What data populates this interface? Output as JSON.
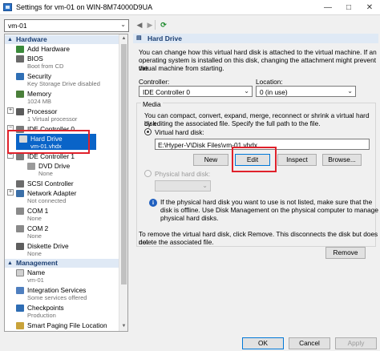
{
  "window": {
    "title": "Settings for vm-01 on WIN-8M74000D9UA"
  },
  "toolbar": {
    "vm_name": "vm-01"
  },
  "tree": {
    "hardware_header": "Hardware",
    "management_header": "Management",
    "items": [
      {
        "label": "Add Hardware",
        "sub": ""
      },
      {
        "label": "BIOS",
        "sub": "Boot from CD"
      },
      {
        "label": "Security",
        "sub": "Key Storage Drive disabled"
      },
      {
        "label": "Memory",
        "sub": "1024 MB"
      },
      {
        "label": "Processor",
        "sub": "1 Virtual processor"
      },
      {
        "label": "IDE Controller 0",
        "sub": ""
      },
      {
        "label": "Hard Drive",
        "sub": "vm-01.vhdx"
      },
      {
        "label": "IDE Controller 1",
        "sub": ""
      },
      {
        "label": "DVD Drive",
        "sub": "None"
      },
      {
        "label": "SCSI Controller",
        "sub": ""
      },
      {
        "label": "Network Adapter",
        "sub": "Not connected"
      },
      {
        "label": "COM 1",
        "sub": "None"
      },
      {
        "label": "COM 2",
        "sub": "None"
      },
      {
        "label": "Diskette Drive",
        "sub": "None"
      }
    ],
    "mgmt_items": [
      {
        "label": "Name",
        "sub": "vm-01"
      },
      {
        "label": "Integration Services",
        "sub": "Some services offered"
      },
      {
        "label": "Checkpoints",
        "sub": "Production"
      },
      {
        "label": "Smart Paging File Location",
        "sub": ""
      }
    ]
  },
  "panel": {
    "header": "Hard Drive",
    "intro": [
      "You can change how this virtual hard disk is attached to the virtual machine. If an",
      "operating system is installed on this disk, changing the attachment might prevent the",
      "virtual machine from starting."
    ],
    "controller_label": "Controller:",
    "controller_value": "IDE Controller 0",
    "location_label": "Location:",
    "location_value": "0 (in use)",
    "media_label": "Media",
    "media_text": [
      "You can compact, convert, expand, merge, reconnect or shrink a virtual hard disk",
      "by editing the associated file. Specify the full path to the file."
    ],
    "vhd_label": "Virtual hard disk:",
    "vhd_path": "E:\\Hyper-V\\Disk Files\\vm-01.vhdx",
    "btn_new": "New",
    "btn_edit": "Edit",
    "btn_inspect": "Inspect",
    "btn_browse": "Browse...",
    "phys_label": "Physical hard disk:",
    "phys_info": [
      "If the physical hard disk you want to use is not listed, make sure that the",
      "disk is offline. Use Disk Management on the physical computer to manage",
      "physical hard disks."
    ],
    "remove_text": [
      "To remove the virtual hard disk, click Remove. This disconnects the disk but does not",
      "delete the associated file."
    ],
    "btn_remove": "Remove"
  },
  "footer": {
    "ok": "OK",
    "cancel": "Cancel",
    "apply": "Apply"
  }
}
